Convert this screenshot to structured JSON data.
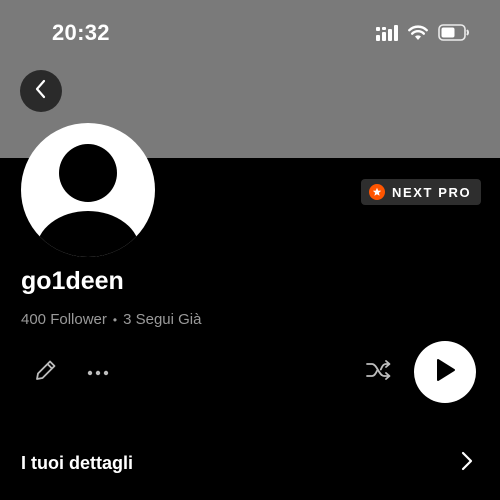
{
  "status_bar": {
    "time": "20:32",
    "signal_icon": "signal-bars-icon",
    "wifi_icon": "wifi-icon",
    "battery_icon": "battery-icon"
  },
  "navigation": {
    "back_icon": "chevron-left-icon"
  },
  "profile": {
    "avatar_icon": "default-user-avatar",
    "badge_label": "NEXT PRO",
    "badge_icon": "star-icon",
    "username": "go1deen",
    "followers": "400 Follower",
    "separator": "•",
    "following": "3 Segui Già"
  },
  "actions": {
    "edit_icon": "pencil-icon",
    "more_icon": "more-dots-icon",
    "shuffle_icon": "shuffle-icon",
    "play_icon": "play-icon"
  },
  "details": {
    "label": "I tuoi dettagli",
    "chevron_icon": "chevron-right-icon"
  },
  "colors": {
    "header_background": "#7a7a7a",
    "page_background": "#000000",
    "badge_accent": "#ff5500",
    "secondary_text": "#9a9a9a"
  }
}
